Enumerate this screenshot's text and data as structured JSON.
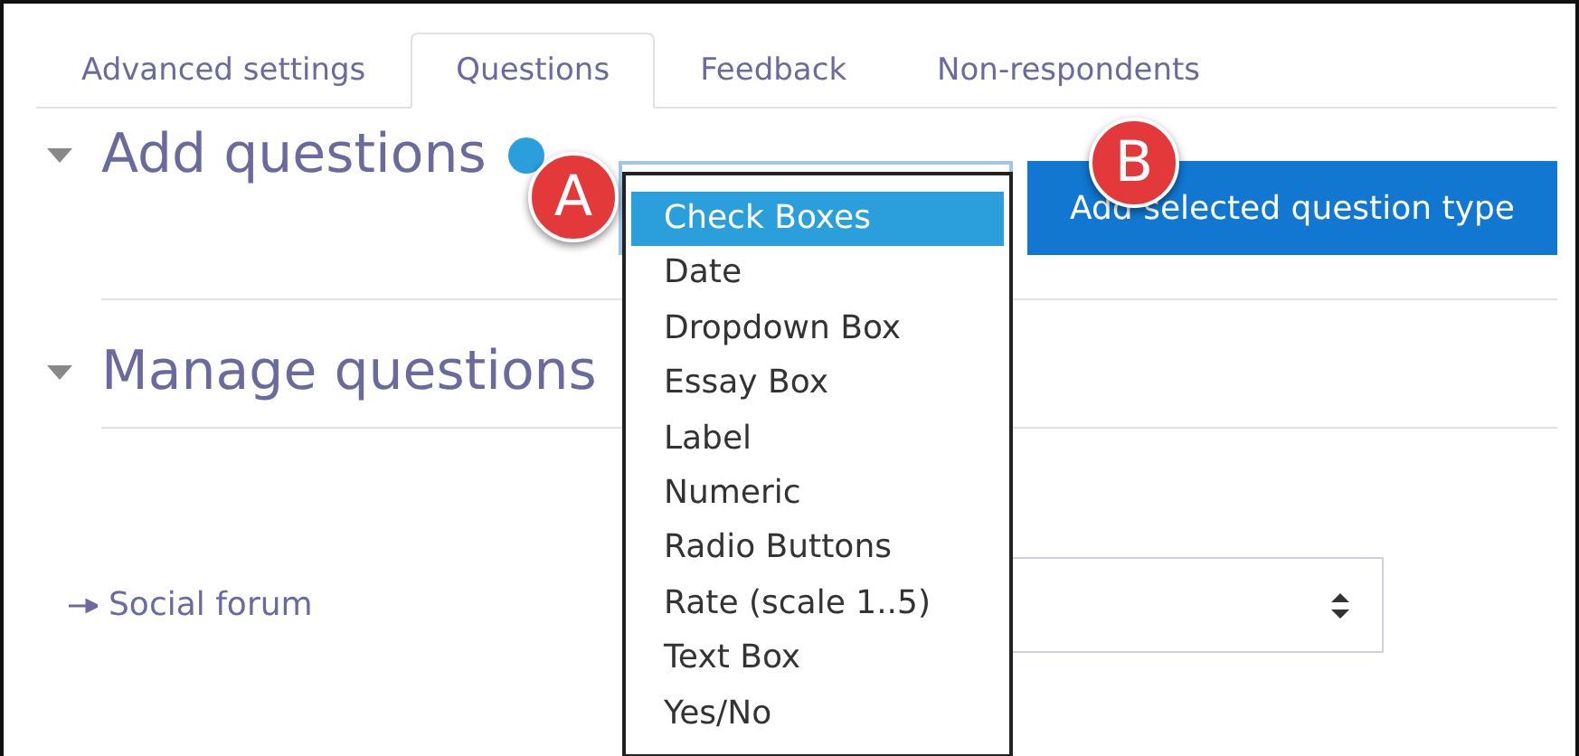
{
  "tabs": [
    {
      "label": "Advanced settings",
      "selected": false
    },
    {
      "label": "Questions",
      "selected": true
    },
    {
      "label": "Feedback",
      "selected": false
    },
    {
      "label": "Non-respondents",
      "selected": false
    }
  ],
  "sections": [
    {
      "title": "Add questions",
      "expanded": true,
      "help": true
    },
    {
      "title": "Manage questions",
      "expanded": true,
      "help": false
    }
  ],
  "question_type_dropdown": {
    "expanded": true,
    "options": [
      {
        "label": "Check Boxes",
        "selected": true
      },
      {
        "label": "Date",
        "selected": false
      },
      {
        "label": "Dropdown Box",
        "selected": false
      },
      {
        "label": "Essay Box",
        "selected": false
      },
      {
        "label": "Label",
        "selected": false
      },
      {
        "label": "Numeric",
        "selected": false
      },
      {
        "label": "Radio Buttons",
        "selected": false
      },
      {
        "label": "Rate (scale 1..5)",
        "selected": false
      },
      {
        "label": "Text Box",
        "selected": false
      },
      {
        "label": "Yes/No",
        "selected": false
      }
    ]
  },
  "add_button": "Add selected question type",
  "callouts": [
    "A",
    "B"
  ],
  "jump_link": "Social forum"
}
